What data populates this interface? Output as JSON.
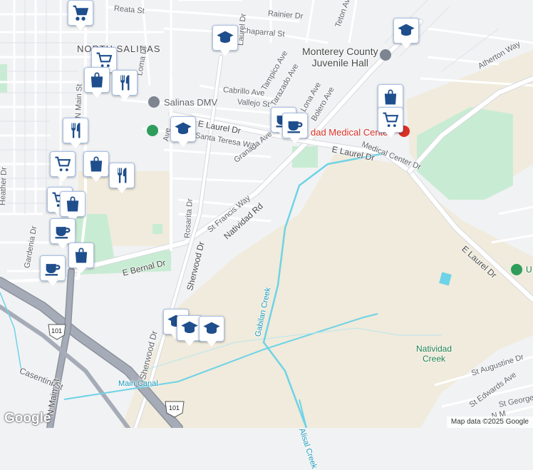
{
  "map": {
    "attribution": "Map data ©2025 Google",
    "logo": "Google",
    "colors": {
      "background": "#f1f2f4",
      "road": "#ffffff",
      "road_outline": "#d6d9de",
      "highway": "#a6acb7",
      "farmland": "#f0ebdc",
      "park": "#c8ecd3",
      "water": "#6ed3e6",
      "marker_blue": "#1f4e8c"
    }
  },
  "labels": {
    "reata_st": "Reata St",
    "rainier_dr": "Rainier Dr",
    "teton_ave": "Teton Ave",
    "chaparral_st": "Chaparral St",
    "laurel_dr_n": "Laurel Dr",
    "north_salinas": "NORTH SALINAS",
    "monterey_juvenile": "Monterey County\nJuvenile Hall",
    "atherton_way": "Atherton Way",
    "salinas_dmv": "Salinas DMV",
    "cabrillo_ave": "Cabrillo Ave",
    "tampico_ave": "Tampico Ave",
    "vallejo_st": "Vallejo St",
    "tarazado_ave": "Tarazado Ave",
    "lona_ave": "Lona Ave",
    "bolero_ave": "Bolero Ave",
    "e_laurel_dr_a": "E Laurel Dr",
    "santa_teresa_way": "Santa Teresa Way",
    "granada_ave": "Granada Ave",
    "medical_center": "Natividad Medical Center",
    "medical_center_partial": "dad Medical Center",
    "medical_center_dr": "Medical Center Dr",
    "e_laurel_dr_b": "E Laurel Dr",
    "e_laurel_dr_c": "E Laurel Dr",
    "heather_dr": "Heather Dr",
    "gardenia_dr": "Gardenia Dr",
    "rosarita_dr": "Rosarita Dr",
    "st_francis_way": "St Francis Way",
    "natividad_rd": "Natividad Rd",
    "sherwood_dr": "Sherwood Dr",
    "sherwood_dr_b": "Sherwood Dr",
    "e_bernal_dr": "E Bernal Dr",
    "gabilan_creek": "Gabilan Creek",
    "natividad_creek": "Natividad\nCreek",
    "st_augustine_dr": "St Augustine Dr",
    "st_edwards_ave": "St Edwards Ave",
    "st_george_dr": "St George Dr",
    "n_main_st_a": "N Main St",
    "n_main_st_b": "N Main St",
    "casentini_st": "Casentini St",
    "main_canal": "Main Canal",
    "alisal_creek": "Alisal Creek",
    "loma_dr": "Loma Dr",
    "ave_partial": "Ave",
    "u_partial": "U",
    "hwy_101_a": "101",
    "hwy_101_b": "101",
    "m_partial": "N M"
  },
  "markers": [
    {
      "id": "m1",
      "type": "shopping-cart"
    },
    {
      "id": "m2",
      "type": "school"
    },
    {
      "id": "m3",
      "type": "school"
    },
    {
      "id": "m4",
      "type": "shopping-cart"
    },
    {
      "id": "m5",
      "type": "shopping-bag"
    },
    {
      "id": "m6",
      "type": "restaurant"
    },
    {
      "id": "m7",
      "type": "school"
    },
    {
      "id": "m8",
      "type": "cafe"
    },
    {
      "id": "m9",
      "type": "shopping-bag"
    },
    {
      "id": "m10",
      "type": "shopping-cart"
    },
    {
      "id": "m11",
      "type": "restaurant"
    },
    {
      "id": "m12",
      "type": "shopping-cart"
    },
    {
      "id": "m13",
      "type": "shopping-bag"
    },
    {
      "id": "m14",
      "type": "restaurant"
    },
    {
      "id": "m15",
      "type": "shopping-cart"
    },
    {
      "id": "m16",
      "type": "shopping-bag"
    },
    {
      "id": "m17",
      "type": "cafe"
    },
    {
      "id": "m18",
      "type": "shopping-bag"
    },
    {
      "id": "m19",
      "type": "cafe"
    },
    {
      "id": "m20",
      "type": "school"
    },
    {
      "id": "m21",
      "type": "school"
    },
    {
      "id": "m22",
      "type": "school"
    }
  ]
}
